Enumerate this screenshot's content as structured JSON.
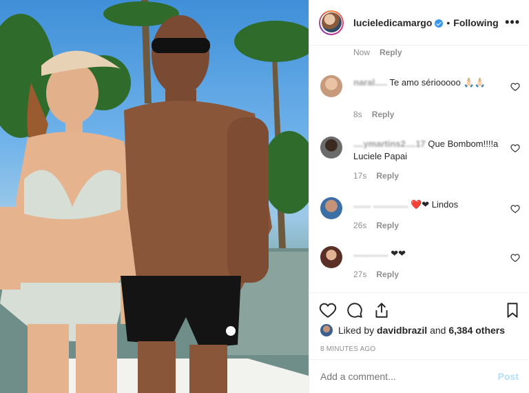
{
  "post": {
    "image_alt": "Couple posing on a boat in swimwear with palm trees behind",
    "colors": {
      "sky": "#3f8fd8",
      "water": "#5d7f82",
      "palm": "#2f6b2a"
    }
  },
  "header": {
    "username": "lucieledicamargo",
    "separator": "•",
    "follow_label": "Following",
    "more_icon": "more-horizontal-icon",
    "more_label": "•••"
  },
  "comments": [
    {
      "user": "",
      "text": "",
      "time": "Now",
      "reply": "Reply"
    },
    {
      "user": "naral.....",
      "text": "Te amo sériooooo 🙏🏻🙏🏻",
      "time": "8s",
      "reply": "Reply"
    },
    {
      "user": "....ymartins2....17",
      "text": "Que Bombom!!!!a Luciele Papai",
      "time": "17s",
      "reply": "Reply"
    },
    {
      "user": "....... ..............",
      "text": "❤️❤ Lindos",
      "time": "26s",
      "reply": "Reply"
    },
    {
      "user": "..............",
      "text": "❤❤",
      "time": "27s",
      "reply": "Reply"
    }
  ],
  "actions": {
    "like_icon": "heart-icon",
    "comment_icon": "comment-icon",
    "share_icon": "share-icon",
    "save_icon": "bookmark-icon",
    "liked_by_prefix": "Liked by ",
    "liked_by_user": "davidbrazil",
    "liked_by_suffix": " and ",
    "liked_by_count": "6,384 others",
    "time_ago": "8 MINUTES AGO"
  },
  "add_comment": {
    "placeholder": "Add a comment...",
    "post_label": "Post",
    "post_color": "#b2dffc"
  }
}
